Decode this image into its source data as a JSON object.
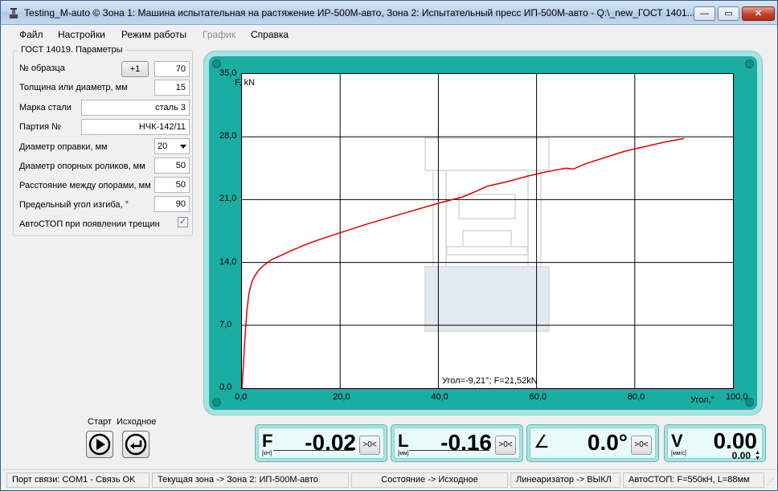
{
  "window": {
    "title": "Testing_M-auto ©  Зона 1: Машина испытательная на растяжение ИР-500М-авто, Зона 2: Испытательный пресс ИП-500М-авто - Q:\\_new_ГОСТ 1401...",
    "minimize": "—",
    "maximize": "▭",
    "close": "✕"
  },
  "menu": {
    "file": "Файл",
    "settings": "Настройки",
    "mode": "Режим работы",
    "graph": "График",
    "help": "Справка"
  },
  "params": {
    "group_title": "ГОСТ 14019. Параметры",
    "sample_no_label": "№ образца",
    "increment_button": "+1",
    "sample_no_value": "70",
    "thickness_label": "Толщина или диаметр, мм",
    "thickness_value": "15",
    "steel_grade_label": "Марка стали",
    "steel_grade_value": "сталь 3",
    "batch_label": "Партия №",
    "batch_value": "НЧК-142/11",
    "mandrel_label": "Диаметр оправки, мм",
    "mandrel_value": "20",
    "rollers_label": "Диаметр опорных роликов, мм",
    "rollers_value": "50",
    "distance_label": "Расстояние между опорами, мм",
    "distance_value": "50",
    "angle_label": "Предельный угол изгиба, °",
    "angle_value": "90",
    "autostop_label": "АвтоСТОП при появлении трещин",
    "autostop_checked": true
  },
  "chart_data": {
    "type": "line",
    "xlabel": "Угол,°",
    "ylabel": "F, kN",
    "xlim": [
      0,
      100
    ],
    "ylim": [
      0,
      35
    ],
    "x_ticks": [
      "0,0",
      "20,0",
      "40,0",
      "60,0",
      "80,0",
      "100,0"
    ],
    "y_ticks": [
      "0,0",
      "7,0",
      "14,0",
      "21,0",
      "28,0",
      "35,0"
    ],
    "grid": true,
    "annotation": "Угол=-9,21°; F=21,52kN",
    "line_color": "#e00000",
    "series": [
      {
        "x": [
          0.0,
          0.3,
          0.6,
          1.0,
          1.4,
          2.0,
          2.6,
          3.5,
          4.5,
          6.0,
          8.0,
          10.0,
          13.0,
          16.0,
          20.0,
          25.0,
          30.0,
          35.0,
          40.0,
          45.0,
          48.0,
          50.0,
          54.0,
          58.0,
          62.0,
          66.0,
          67.5,
          70.0,
          74.0,
          78.0,
          82.0,
          86.0,
          90.0
        ],
        "y": [
          0.0,
          2.5,
          5.5,
          8.5,
          10.5,
          11.8,
          12.5,
          13.2,
          13.7,
          14.3,
          14.8,
          15.3,
          16.0,
          16.6,
          17.3,
          18.2,
          19.0,
          19.8,
          20.6,
          21.3,
          22.0,
          22.5,
          23.0,
          23.6,
          24.1,
          24.5,
          24.4,
          25.0,
          25.7,
          26.4,
          26.9,
          27.4,
          27.8
        ]
      }
    ]
  },
  "controls": {
    "start_label": "Старт",
    "reset_label": "Исходное"
  },
  "indicators": {
    "force": {
      "symbol": "F",
      "unit": "[кН]",
      "value": "-0.02",
      "zero_button": ">0<"
    },
    "length": {
      "symbol": "L",
      "unit": "[мм]",
      "value": "-0.16",
      "zero_button": ">0<"
    },
    "angle": {
      "symbol": "∠",
      "value": "0.0°",
      "zero_button": ">0<"
    },
    "velocity": {
      "symbol": "V",
      "unit": "[мм/с]",
      "value": "0.00",
      "setpoint": "0.00"
    }
  },
  "status": {
    "port": "Порт связи: COM1 - Связь OK",
    "zone": "Текущая зона -> Зона 2: ИП-500М-авто",
    "state": "Состояние -> Исходное",
    "linearizer": "Линеаризатор -> ВЫКЛ",
    "autostop": "АвтоСТОП: F=550кН, L=88мм"
  }
}
